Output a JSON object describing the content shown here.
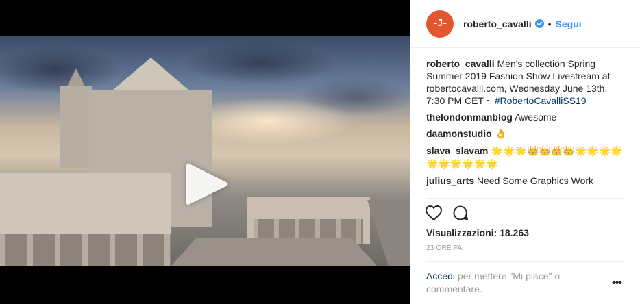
{
  "post": {
    "username": "roberto_cavalli",
    "separator": "•",
    "follow_label": "Segui",
    "avatar_text": "-J-"
  },
  "caption": {
    "user": "roberto_cavalli",
    "text": " Men's collection Spring Summer 2019 Fashion Show Livestream at robertocavalli.com, Wednesday June 13th, 7:30 PM CET ~ ",
    "hashtag": "#RobertoCavalliSS19"
  },
  "comments": [
    {
      "user": "thelondonmanblog",
      "text": " Awesome"
    },
    {
      "user": "daamonstudio",
      "text": " 👌"
    },
    {
      "user": "slava_slavam",
      "text": " 🌟🌟🌟👑👑👑👑🌟🌟🌟🌟🌟🌟🌟🌟🌟🌟"
    },
    {
      "user": "julius_arts",
      "text": " Need Some Graphics Work"
    }
  ],
  "icons": {
    "like": "heart-icon",
    "comment": "comment-icon",
    "play": "play-icon",
    "verified": "verified-badge-icon",
    "more": "more-options-icon"
  },
  "stats": {
    "views": "Visualizzazioni: 18.263",
    "time": "23 ORE FA"
  },
  "login": {
    "link": "Accedi",
    "text": " per mettere \"Mi piace\" o commentare."
  },
  "more_label": "•••",
  "colors": {
    "accent": "#3897f0",
    "link": "#003569",
    "avatar": "#e2572f"
  }
}
